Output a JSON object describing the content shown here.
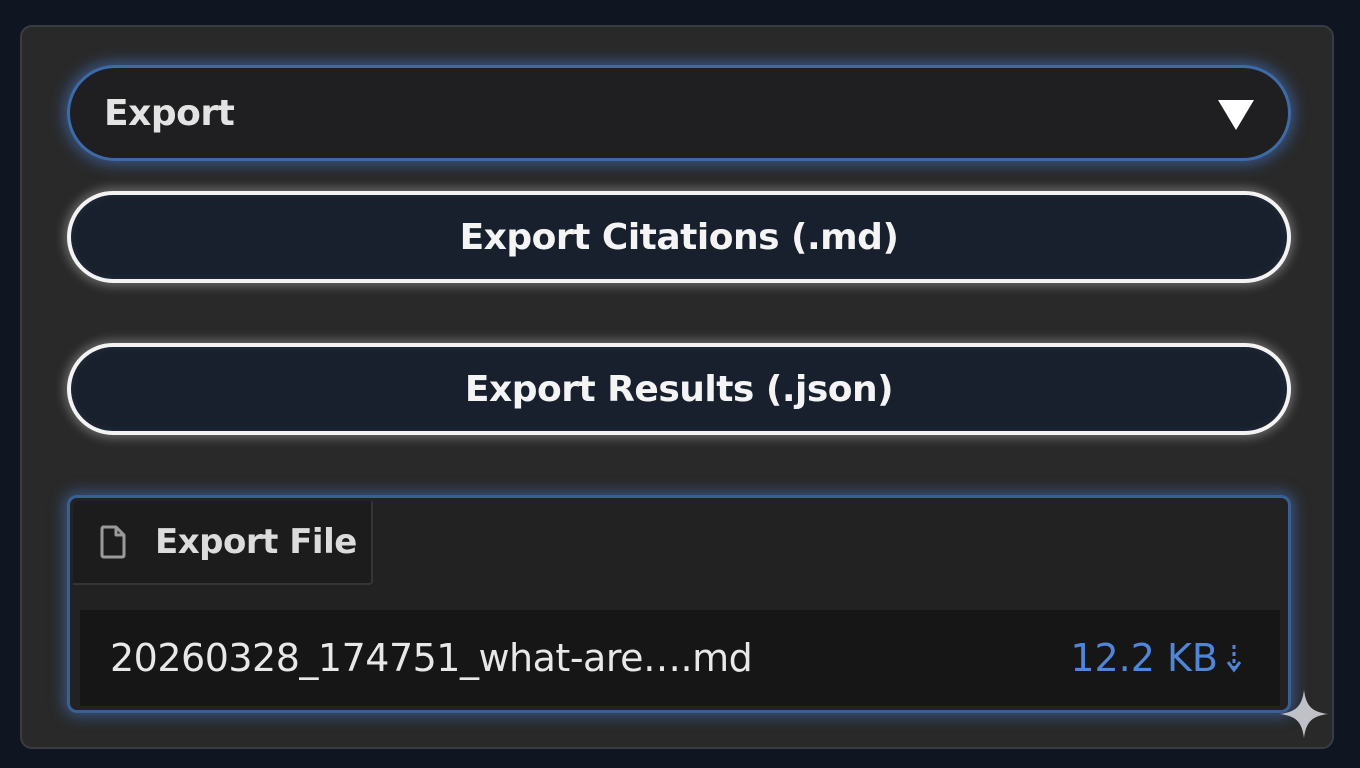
{
  "accordion": {
    "label": "Export",
    "icon": "caret-down-icon"
  },
  "buttons": {
    "export_citations": "Export Citations (.md)",
    "export_results": "Export Results (.json)"
  },
  "file_panel": {
    "tab_label": "Export File",
    "tab_icon": "file-icon",
    "file_name": "20260328_174751_what-are….md",
    "file_size": "12.2 KB",
    "download_icon": "download-icon"
  },
  "colors": {
    "background": "#0f1621",
    "panel": "#292929",
    "accent_blue": "#4f86d9",
    "button_border": "#f3f3f3"
  }
}
